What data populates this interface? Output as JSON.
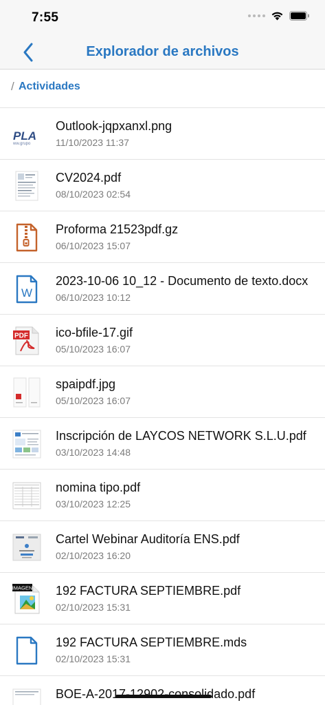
{
  "status_bar": {
    "time": "7:55"
  },
  "nav": {
    "title": "Explorador de archivos",
    "back_icon": "chevron-left-icon"
  },
  "breadcrumb": {
    "separator": "/",
    "item": "Actividades"
  },
  "colors": {
    "accent": "#2a78c2",
    "zip_icon": "#c4622b",
    "doc_icon": "#2a78c2"
  },
  "files": [
    {
      "name": "Outlook-jqpxanxl.png",
      "date": "11/10/2023 11:37",
      "thumb": "image-thumbnail",
      "thumb_logo": "PLA",
      "thumb_caption": "ww.grupo"
    },
    {
      "name": "CV2024.pdf",
      "date": "08/10/2023 02:54",
      "thumb": "document-thumbnail"
    },
    {
      "name": "Proforma 21523pdf.gz",
      "date": "06/10/2023 15:07",
      "thumb": "zip-file-icon"
    },
    {
      "name": "2023-10-06 10_12 - Documento de texto.docx",
      "date": "06/10/2023 10:12",
      "thumb": "word-file-icon",
      "thumb_letter": "W"
    },
    {
      "name": "ico-bfile-17.gif",
      "date": "05/10/2023 16:07",
      "thumb": "pdf-file-icon",
      "thumb_label": "PDF"
    },
    {
      "name": "spaipdf.jpg",
      "date": "05/10/2023 16:07",
      "thumb": "image-thumbnail"
    },
    {
      "name": "Inscripción de LAYCOS NETWORK S.L.U.pdf",
      "date": "03/10/2023 14:48",
      "thumb": "document-thumbnail"
    },
    {
      "name": "nomina tipo.pdf",
      "date": "03/10/2023 12:25",
      "thumb": "document-thumbnail"
    },
    {
      "name": "Cartel Webinar Auditoría ENS.pdf",
      "date": "02/10/2023 16:20",
      "thumb": "document-thumbnail"
    },
    {
      "name": "192 FACTURA SEPTIEMBRE.pdf",
      "date": "02/10/2023 15:31",
      "thumb": "image-file-icon",
      "thumb_label": "IMAGEN"
    },
    {
      "name": "192 FACTURA SEPTIEMBRE.mds",
      "date": "02/10/2023 15:31",
      "thumb": "generic-file-icon"
    },
    {
      "name": "BOE-A-2017-12902-consolidado.pdf",
      "date": "",
      "thumb": "document-thumbnail"
    }
  ]
}
